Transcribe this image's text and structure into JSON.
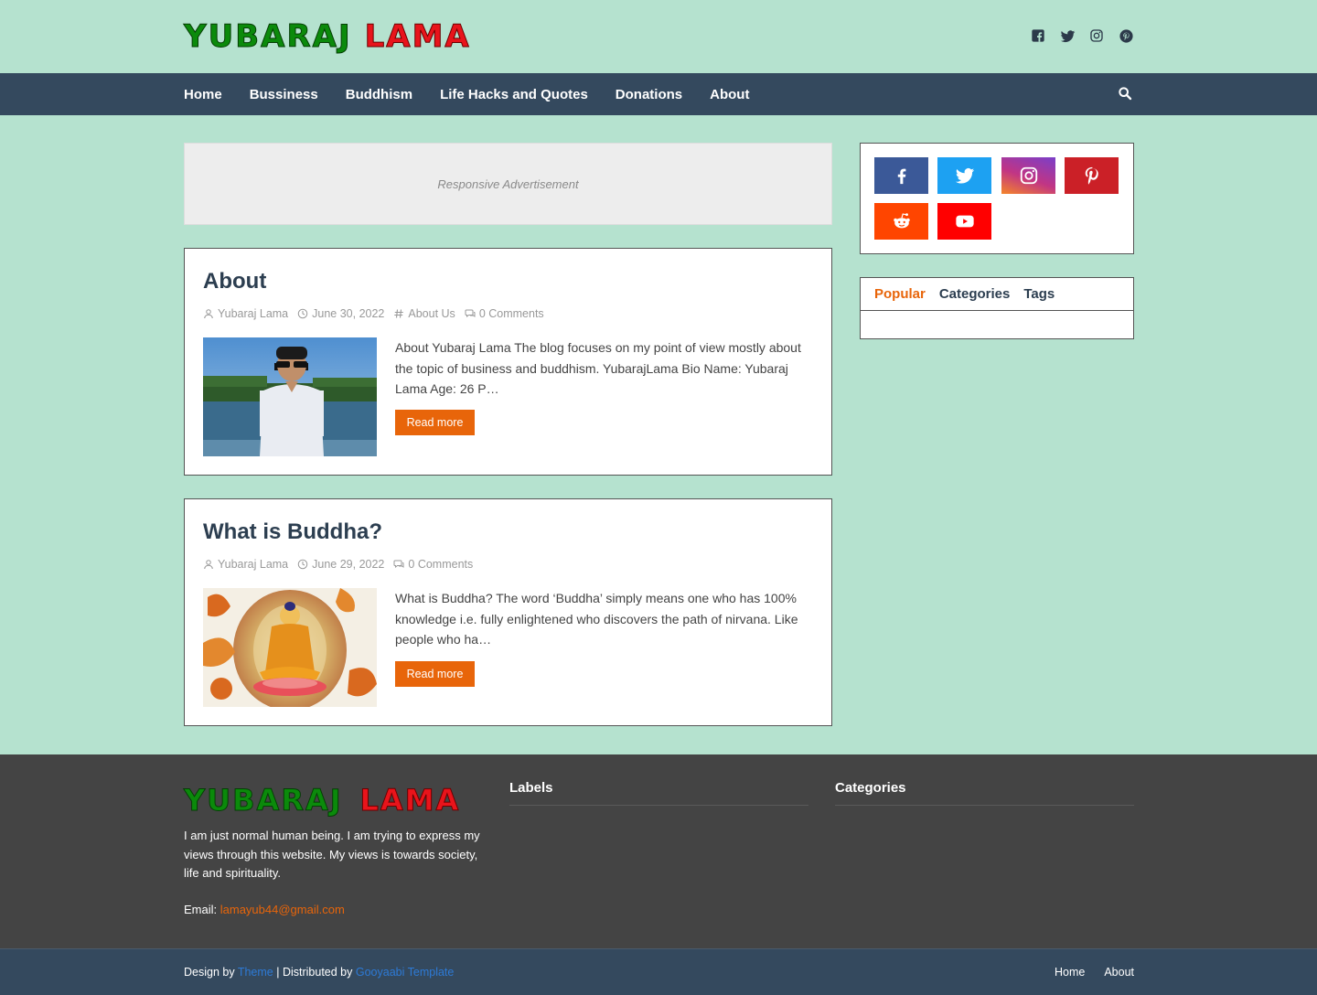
{
  "header": {
    "logo_first": "YUBARAJ",
    "logo_second": "LAMA",
    "social_icons": [
      "facebook-icon",
      "twitter-icon",
      "instagram-icon",
      "pinterest-icon"
    ]
  },
  "nav": {
    "items": [
      "Home",
      "Bussiness",
      "Buddhism",
      "Life Hacks and Quotes",
      "Donations",
      "About"
    ]
  },
  "ad": {
    "label": "Responsive Advertisement"
  },
  "posts": [
    {
      "title": "About",
      "author": "Yubaraj Lama",
      "date": "June 30, 2022",
      "label": "About Us",
      "comments": "0 Comments",
      "excerpt": "About Yubaraj Lama The blog focuses on my point of view mostly about the topic of business and buddhism.  YubarajLama Bio Name:  Yubaraj Lama Age:  26 P…",
      "read_more": "Read more"
    },
    {
      "title": "What is Buddha?",
      "author": "Yubaraj Lama",
      "date": "June 29, 2022",
      "comments": "0 Comments",
      "excerpt": "What is Buddha? The word ‘Buddha’ simply means one who has 100% knowledge i.e. fully enlightened who discovers the path of nirvana. Like people who ha…",
      "read_more": "Read more"
    }
  ],
  "sidebar": {
    "social_buttons": [
      {
        "icon": "facebook-icon",
        "color": "#3b5998"
      },
      {
        "icon": "twitter-icon",
        "color": "#1da1f2"
      },
      {
        "icon": "instagram-icon",
        "color": "#c13584"
      },
      {
        "icon": "pinterest-icon",
        "color": "#cb2027"
      },
      {
        "icon": "reddit-icon",
        "color": "#ff4500"
      },
      {
        "icon": "youtube-icon",
        "color": "#ff0000"
      }
    ],
    "tabs": [
      "Popular",
      "Categories",
      "Tags"
    ]
  },
  "footer": {
    "about_text": "I am just normal human being. I am trying to express my views through this website. My views is towards society, life and spirituality.",
    "email_label": "Email:",
    "email": "lamayub44@gmail.com",
    "labels_title": "Labels",
    "categories_title": "Categories",
    "credit_design": "Design by",
    "credit_theme": "Theme",
    "credit_dist": "| Distributed by",
    "credit_gooyaabi": "Gooyaabi Template",
    "bottom_links": [
      "Home",
      "About"
    ]
  },
  "colors": {
    "background": "#b5e2cf",
    "nav": "#34495e",
    "accent": "#e8650a",
    "footer": "#444444"
  }
}
